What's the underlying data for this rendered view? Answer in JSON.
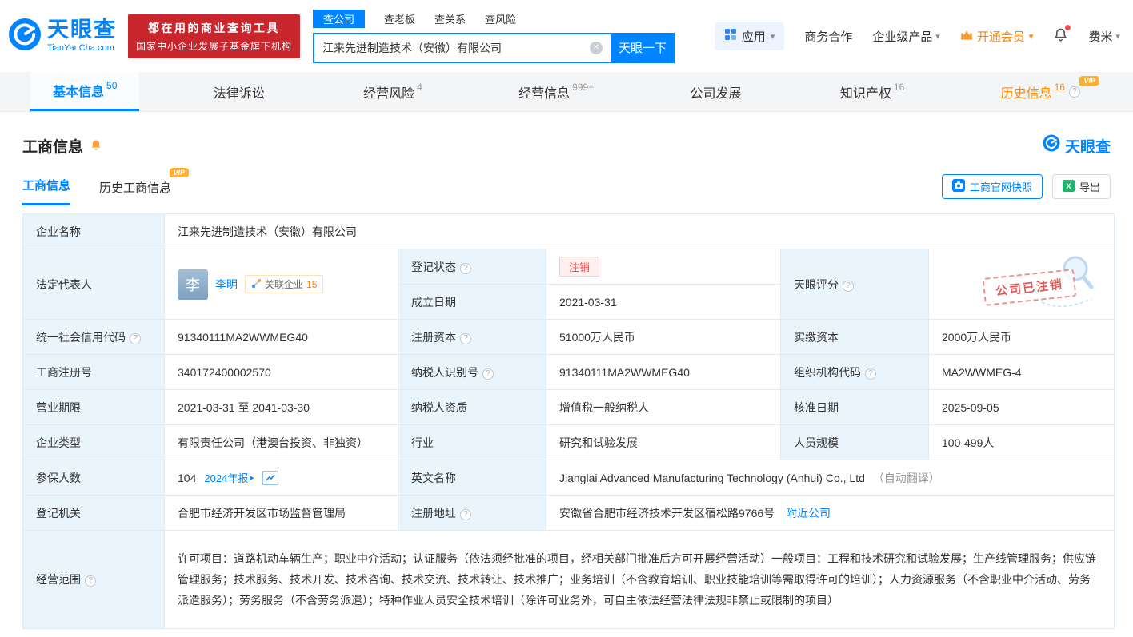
{
  "brand": {
    "name": "天眼查",
    "domain": "TianYanCha.com",
    "slogan1": "都在用的商业查询工具",
    "slogan2": "国家中小企业发展子基金旗下机构",
    "accent_blue": "#0084ff",
    "accent_orange": "#ff8000",
    "slogan_red": "#c9252c"
  },
  "search": {
    "tabs": [
      {
        "label": "查公司"
      },
      {
        "label": "查老板"
      },
      {
        "label": "查关系"
      },
      {
        "label": "查风险"
      }
    ],
    "value": "江来先进制造技术（安徽）有限公司",
    "button": "天眼一下"
  },
  "topmenu": {
    "apps": "应用",
    "cooperation": "商务合作",
    "enterprise": "企业级产品",
    "vip": "开通会员",
    "username": "费米"
  },
  "nav": {
    "vip_tag": "VIP",
    "tabs": [
      {
        "label": "基本信息",
        "count": "50"
      },
      {
        "label": "法律诉讼",
        "count": ""
      },
      {
        "label": "经营风险",
        "count": "4"
      },
      {
        "label": "经营信息",
        "count": "999+"
      },
      {
        "label": "公司发展",
        "count": ""
      },
      {
        "label": "知识产权",
        "count": "16"
      },
      {
        "label": "历史信息",
        "count": "16"
      }
    ]
  },
  "section": {
    "title": "工商信息",
    "logo": "天眼查",
    "tab1": "工商信息",
    "tab2": "历史工商信息",
    "vip_tag": "VIP",
    "snapshot_btn": "工商官网快照",
    "export_btn": "导出"
  },
  "table": {
    "company": {
      "label": "企业名称",
      "value": "江来先进制造技术（安徽）有限公司"
    },
    "legal": {
      "label": "法定代表人",
      "avatar": "李",
      "name": "李明",
      "related": "关联企业",
      "related_count": "15"
    },
    "status": {
      "label": "登记状态",
      "value": "注销"
    },
    "established": {
      "label": "成立日期",
      "value": "2021-03-31"
    },
    "score": {
      "label": "天眼评分",
      "stamp": "公司已注销"
    },
    "rows": [
      {
        "c0l": "统一社会信用代码",
        "c0v": "91340111MA2WWMEG40",
        "c1l": "注册资本",
        "c1v": "51000万人民币",
        "c2l": "实缴资本",
        "c2v": "2000万人民币"
      },
      {
        "c0l": "工商注册号",
        "c0v": "340172400002570",
        "c1l": "纳税人识别号",
        "c1v": "91340111MA2WWMEG40",
        "c2l": "组织机构代码",
        "c2v": "MA2WWMEG-4"
      },
      {
        "c0l": "营业期限",
        "c0v": "2021-03-31 至 2041-03-30",
        "c1l": "纳税人资质",
        "c1v": "增值税一般纳税人",
        "c2l": "核准日期",
        "c2v": "2025-09-05"
      },
      {
        "c0l": "企业类型",
        "c0v": "有限责任公司（港澳台投资、非独资）",
        "c1l": "行业",
        "c1v": "研究和试验发展",
        "c2l": "人员规模",
        "c2v": "100-499人"
      }
    ],
    "insured": {
      "label": "参保人数",
      "value": "104",
      "report": "2024年报"
    },
    "english": {
      "label": "英文名称",
      "value": "Jianglai Advanced Manufacturing Technology (Anhui) Co., Ltd",
      "note": "（自动翻译）"
    },
    "authority": {
      "label": "登记机关",
      "value": "合肥市经济开发区市场监督管理局"
    },
    "address": {
      "label": "注册地址",
      "value": "安徽省合肥市经济技术开发区宿松路9766号",
      "nearby": "附近公司"
    },
    "scope": {
      "label": "经营范围",
      "value": "许可项目：道路机动车辆生产；职业中介活动；认证服务（依法须经批准的项目，经相关部门批准后方可开展经营活动）一般项目：工程和技术研究和试验发展；生产线管理服务；供应链管理服务；技术服务、技术开发、技术咨询、技术交流、技术转让、技术推广；业务培训（不含教育培训、职业技能培训等需取得许可的培训）；人力资源服务（不含职业中介活动、劳务派遣服务）；劳务服务（不含劳务派遣）；特种作业人员安全技术培训（除许可业务外，可自主依法经营法律法规非禁止或限制的项目）"
    }
  },
  "icons": {
    "help": "?",
    "caret": "▾",
    "arrow": "▸",
    "clear": "✕"
  }
}
